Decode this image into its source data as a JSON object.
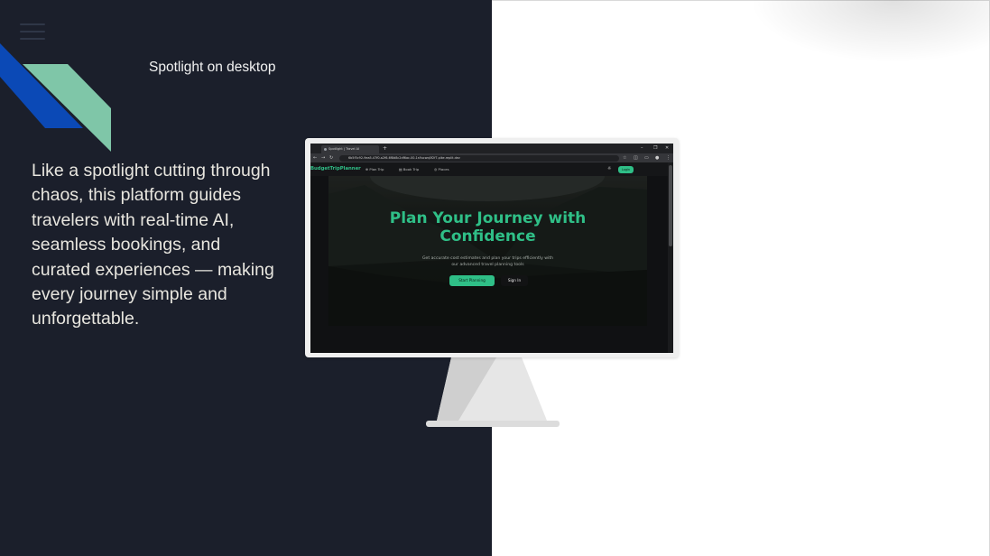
{
  "slide": {
    "title": "Spotlight on desktop",
    "body": "Like a spotlight cutting through chaos, this platform guides travelers with real-time AI, seamless bookings, and curated experiences — making every journey simple and unforgettable."
  },
  "colors": {
    "left_background": "#1b1f2b",
    "accent_green": "#2fbf87",
    "deco_blue": "#0b49b6",
    "deco_mint": "#7fc6a8"
  },
  "browser": {
    "tab_title": "Spotlight | Travel AI",
    "new_tab_label": "+",
    "window_controls": [
      "–",
      "❐",
      "✕"
    ],
    "nav_buttons": [
      "←",
      "→",
      "↻"
    ],
    "url": "6b5f5c92-9ea5-47f0-a2f6-6f8d8c2df6ac-00-1s9ucwq0f2f7.pike.replit.dev",
    "toolbar_icons": [
      "star-icon",
      "extensions-icon",
      "profile-icon",
      "menu-icon"
    ]
  },
  "app": {
    "logo": "BudgetTripPlanner",
    "nav": [
      "Plan Trip",
      "Book Trip",
      "Places"
    ],
    "login_label": "Login",
    "hero": {
      "title_line1": "Plan Your Journey with",
      "title_line2": "Confidence",
      "subtitle": "Get accurate cost estimates and plan your trips efficiently with our advanced travel planning tools",
      "primary_button": "Start Planning",
      "secondary_button": "Sign In"
    }
  }
}
